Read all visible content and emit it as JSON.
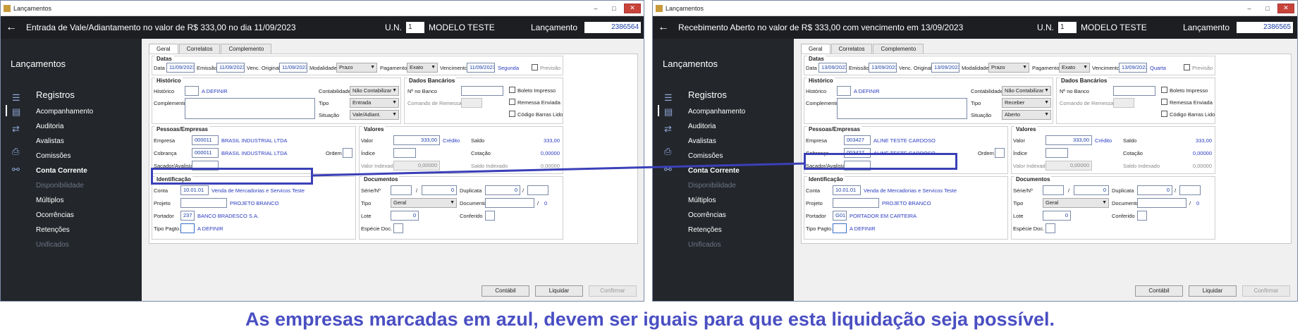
{
  "w1": {
    "window_title": "Lançamentos",
    "header": {
      "title": "Entrada de Vale/Adiantamento no valor de R$ 333,00 no dia 11/09/2023",
      "un_label": "U.N.",
      "un_value": "1",
      "un_name": "MODELO TESTE",
      "lanc_label": "Lançamento",
      "lanc_value": "2386564"
    },
    "sidebar": {
      "title": "Lançamentos",
      "section": "Registros",
      "items": [
        "Acompanhamento",
        "Auditoria",
        "Avalistas",
        "Comissões",
        "Conta Corrente",
        "Disponibilidade",
        "Múltiplos",
        "Ocorrências",
        "Retenções",
        "Unificados"
      ]
    },
    "tabs": [
      "Geral",
      "Correlatos",
      "Complemento"
    ],
    "datas": {
      "title": "Datas",
      "data_l": "Data",
      "data": "11/09/2023",
      "emissao_l": "Emissão",
      "emissao": "11/09/2023",
      "venc_orig_l": "Venc. Original",
      "venc_orig": "11/09/2023",
      "modalidade_l": "Modalidade",
      "modalidade": "Prazo",
      "pagamento_l": "Pagamento",
      "pagamento": "Exato",
      "vencimento_l": "Vencimento",
      "vencimento": "11/09/2023",
      "dia": "Segunda",
      "previsao_l": "Previsão"
    },
    "historico": {
      "title": "Histórico",
      "hist_l": "Histórico",
      "hist_desc": "A DEFINIR",
      "compl_l": "Complemento",
      "contab_l": "Contabilidade",
      "contab": "Não Contabilizar",
      "tipo_l": "Tipo",
      "tipo": "Entrada",
      "sit_l": "Situação",
      "sit": "Vale/Adiant."
    },
    "banco": {
      "title": "Dados Bancários",
      "nbanco_l": "Nº no Banco",
      "remessa_l": "Comando de Remessa",
      "boleto_l": "Boleto Impresso",
      "rem_env_l": "Remessa Enviada",
      "cod_barras_l": "Código Barras Lido"
    },
    "pessoas": {
      "title": "Pessoas/Empresas",
      "empresa_l": "Empresa",
      "empresa_cod": "000011",
      "empresa_nome": "BRASIL INDUSTRIAL  LTDA",
      "cobranca_l": "Cobrança",
      "cobranca_cod": "000011",
      "cobranca_nome": "BRASIL INDUSTRIAL  LTDA",
      "ordem_l": "Ordem",
      "sacador_l": "Sacador/Avalista"
    },
    "valores": {
      "title": "Valores",
      "valor_l": "Valor",
      "valor": "333,00",
      "credito": "Crédito",
      "saldo_l": "Saldo",
      "saldo": "333,00",
      "indice_l": "Índice",
      "cotacao_l": "Cotação",
      "cotacao": "0,00000",
      "vindex_l": "Valor Indexado",
      "vindex": "0,00000",
      "sindex_l": "Saldo Indexado",
      "sindex": "0,00000"
    },
    "ident": {
      "title": "Identificação",
      "conta_l": "Conta",
      "conta": "10.01.01",
      "conta_nome": "Venda de Mercadorias e Servicos Teste",
      "projeto_l": "Projeto",
      "projeto_nome": "PROJETO BRANCO",
      "portador_l": "Portador",
      "portador": "237",
      "portador_nome": "BANCO BRADESCO S.A.",
      "tipopag_l": "Tipo Pagto.",
      "tipopag_nome": "A DEFINIR"
    },
    "docs": {
      "title": "Documentos",
      "serie_l": "Série/Nº",
      "serie_sep": "/",
      "serie_n": "0",
      "dup_l": "Duplicata",
      "dup": "0",
      "dup_sep": "/",
      "tipo_l": "Tipo",
      "tipo": "Geral",
      "doc_l": "Documento",
      "doc_sep": "/",
      "doc_n": "0",
      "lote_l": "Lote",
      "lote": "0",
      "conf_l": "Conferido",
      "esp_l": "Espécie Doc."
    },
    "buttons": {
      "contabil": "Contábil",
      "liquidar": "Liquidar",
      "confirmar": "Confirmar"
    }
  },
  "w2": {
    "window_title": "Lançamentos",
    "header": {
      "title": "Recebimento Aberto no valor de R$ 333,00 com vencimento em 13/09/2023",
      "un_label": "U.N.",
      "un_value": "1",
      "un_name": "MODELO TESTE",
      "lanc_label": "Lançamento",
      "lanc_value": "2386565"
    },
    "sidebar": {
      "title": "Lançamentos",
      "section": "Registros",
      "items": [
        "Acompanhamento",
        "Auditoria",
        "Avalistas",
        "Comissões",
        "Conta Corrente",
        "Disponibilidade",
        "Múltiplos",
        "Ocorrências",
        "Retenções",
        "Unificados"
      ]
    },
    "tabs": [
      "Geral",
      "Correlatos",
      "Complemento"
    ],
    "datas": {
      "title": "Datas",
      "data_l": "Data",
      "data": "13/09/2023",
      "emissao_l": "Emissão",
      "emissao": "13/09/2023",
      "venc_orig_l": "Venc. Original",
      "venc_orig": "13/09/2023",
      "modalidade_l": "Modalidade",
      "modalidade": "Prazo",
      "pagamento_l": "Pagamento",
      "pagamento": "Exato",
      "vencimento_l": "Vencimento",
      "vencimento": "13/09/2023",
      "dia": "Quarta",
      "previsao_l": "Previsão"
    },
    "historico": {
      "title": "Histórico",
      "hist_l": "Histórico",
      "hist_desc": "A DEFINIR",
      "compl_l": "Complemento",
      "contab_l": "Contabilidade",
      "contab": "Não Contabilizar",
      "tipo_l": "Tipo",
      "tipo": "Receber",
      "sit_l": "Situação",
      "sit": "Aberto"
    },
    "banco": {
      "title": "Dados Bancários",
      "nbanco_l": "Nº no Banco",
      "remessa_l": "Comando de Remessa",
      "boleto_l": "Boleto Impresso",
      "rem_env_l": "Remessa Enviada",
      "cod_barras_l": "Código Barras Lido"
    },
    "pessoas": {
      "title": "Pessoas/Empresas",
      "empresa_l": "Empresa",
      "empresa_cod": "003427",
      "empresa_nome": "ALINE TESTE CARDOSO",
      "cobranca_l": "Cobrança",
      "cobranca_cod": "003427",
      "cobranca_nome": "ALINE TESTE CARDOSO",
      "ordem_l": "Ordem",
      "sacador_l": "Sacador/Avalista"
    },
    "valores": {
      "title": "Valores",
      "valor_l": "Valor",
      "valor": "333,00",
      "credito": "Crédito",
      "saldo_l": "Saldo",
      "saldo": "333,00",
      "indice_l": "Índice",
      "cotacao_l": "Cotação",
      "cotacao": "0,00000",
      "vindex_l": "Valor Indexado",
      "vindex": "0,00000",
      "sindex_l": "Saldo Indexado",
      "sindex": "0,00000"
    },
    "ident": {
      "title": "Identificação",
      "conta_l": "Conta",
      "conta": "10.01.01",
      "conta_nome": "Venda de Mercadorias e Servicos Teste",
      "projeto_l": "Projeto",
      "projeto_nome": "PROJETO BRANCO",
      "portador_l": "Portador",
      "portador": "G01",
      "portador_nome": "PORTADOR EM CARTEIRA",
      "tipopag_l": "Tipo Pagto.",
      "tipopag_nome": "A DEFINIR"
    },
    "docs": {
      "title": "Documentos",
      "serie_l": "Série/Nº",
      "serie_sep": "/",
      "serie_n": "0",
      "dup_l": "Duplicata",
      "dup": "0",
      "dup_sep": "/",
      "tipo_l": "Tipo",
      "tipo": "Geral",
      "doc_l": "Documento",
      "doc_sep": "/",
      "doc_n": "0",
      "lote_l": "Lote",
      "lote": "0",
      "conf_l": "Conferido",
      "esp_l": "Espécie Doc."
    },
    "buttons": {
      "contabil": "Contábil",
      "liquidar": "Liquidar",
      "confirmar": "Confirmar"
    }
  },
  "caption": "As empresas marcadas em azul, devem ser iguais para que esta liquidação seja possível.",
  "colors": {
    "highlight": "#3b40b8",
    "sidebar_bg": "#23262b",
    "header_bg": "#1c1e22",
    "link_blue": "#2a3bbf"
  }
}
